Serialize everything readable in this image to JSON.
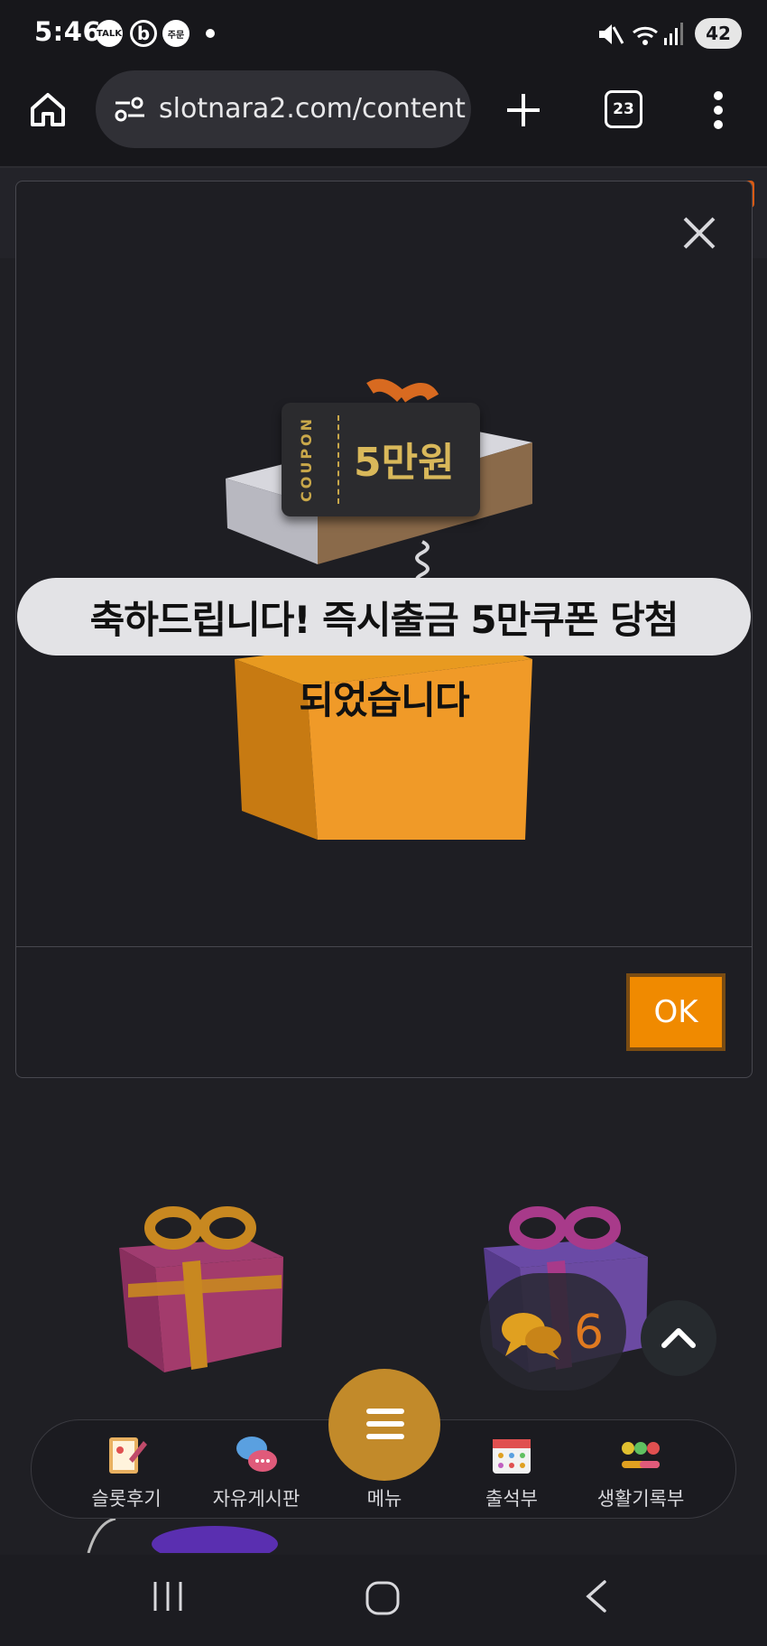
{
  "status_bar": {
    "time": "5:46",
    "icons": [
      "talk-icon",
      "b-app-icon",
      "order-icon"
    ],
    "talk_label": "TALK",
    "order_label": "주문",
    "battery": "42"
  },
  "browser": {
    "url": "slotnara2.com/content",
    "tab_count": "23"
  },
  "modal": {
    "coupon_side_text": "COUPON",
    "coupon_amount": "5만원",
    "message_line1": "축하드립니다! 즉시출금 5만쿠폰 당첨",
    "message_line2": "되었습니다",
    "ok_label": "OK"
  },
  "floating": {
    "chat_count": "6"
  },
  "bottom_nav": {
    "items": [
      {
        "label": "슬롯후기",
        "icon": "review-icon"
      },
      {
        "label": "자유게시판",
        "icon": "chat-board-icon"
      },
      {
        "label": "메뉴",
        "icon": "menu-icon"
      },
      {
        "label": "출석부",
        "icon": "calendar-icon"
      },
      {
        "label": "생활기록부",
        "icon": "emoji-record-icon"
      }
    ]
  },
  "colors": {
    "accent_orange": "#f08a00",
    "menu_gold": "#c28a2a",
    "background": "#1c1c21"
  }
}
